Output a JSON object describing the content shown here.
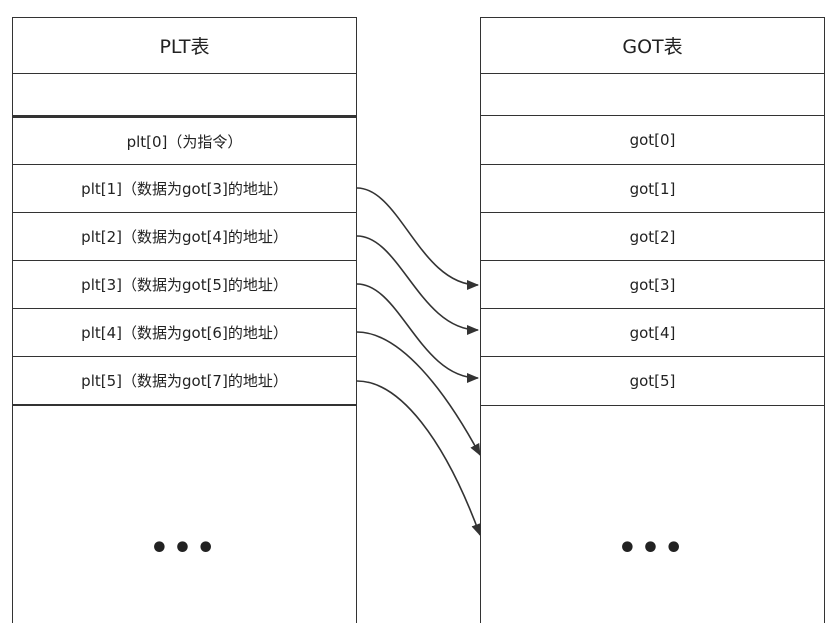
{
  "plt_table": {
    "title": "PLT表",
    "rows": [
      "plt[0]（为指令）",
      "plt[1]（数据为got[3]的地址）",
      "plt[2]（数据为got[4]的地址）",
      "plt[3]（数据为got[5]的地址）",
      "plt[4]（数据为got[6]的地址）",
      "plt[5]（数据为got[7]的地址）"
    ],
    "ellipsis": "•••"
  },
  "got_table": {
    "title": "GOT表",
    "rows": [
      "got[0]",
      "got[1]",
      "got[2]",
      "got[3]",
      "got[4]",
      "got[5]"
    ],
    "ellipsis": "•••"
  }
}
